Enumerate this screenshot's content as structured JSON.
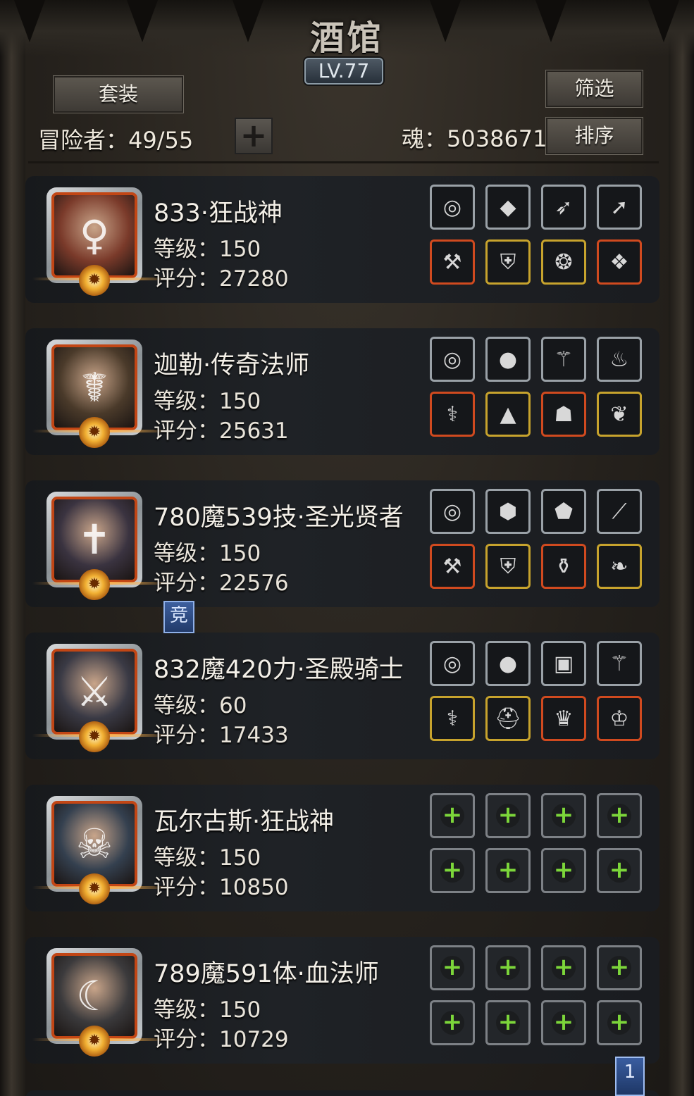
{
  "header": {
    "title": "酒馆",
    "level": "LV.77",
    "set_button": "套装",
    "filter_button": "筛选",
    "sort_button": "排序",
    "adventurers": "冒险者：49/55",
    "add_symbol": "+",
    "soul": "魂：5038671"
  },
  "heroes": [
    {
      "name": "833·狂战神",
      "level": "等级：150",
      "score": "评分：27280",
      "portrait_color": "#7a3a2a",
      "portrait_glyph": "♀",
      "equipment": [
        {
          "icon": "ring",
          "rarity": "silver"
        },
        {
          "icon": "gem",
          "rarity": "silver"
        },
        {
          "icon": "bow",
          "rarity": "silver"
        },
        {
          "icon": "spear",
          "rarity": "silver"
        },
        {
          "icon": "axe",
          "rarity": "red"
        },
        {
          "icon": "armor",
          "rarity": "gold"
        },
        {
          "icon": "circlet",
          "rarity": "gold"
        },
        {
          "icon": "cloak",
          "rarity": "red"
        }
      ]
    },
    {
      "name": "迦勒·传奇法师",
      "level": "等级：150",
      "score": "评分：25631",
      "portrait_color": "#4a3a2a",
      "portrait_glyph": "☤",
      "equipment": [
        {
          "icon": "ring",
          "rarity": "silver"
        },
        {
          "icon": "orb",
          "rarity": "silver"
        },
        {
          "icon": "scepter",
          "rarity": "silver"
        },
        {
          "icon": "lantern",
          "rarity": "silver"
        },
        {
          "icon": "staff",
          "rarity": "red"
        },
        {
          "icon": "robe",
          "rarity": "gold"
        },
        {
          "icon": "mask",
          "rarity": "red"
        },
        {
          "icon": "amulet",
          "rarity": "gold"
        }
      ]
    },
    {
      "name": "780魔539技·圣光贤者",
      "level": "等级：150",
      "score": "评分：22576",
      "portrait_color": "#3a3340",
      "portrait_glyph": "✝",
      "equipment": [
        {
          "icon": "ring",
          "rarity": "silver"
        },
        {
          "icon": "stone",
          "rarity": "silver"
        },
        {
          "icon": "crystal",
          "rarity": "silver"
        },
        {
          "icon": "wand",
          "rarity": "silver"
        },
        {
          "icon": "mace",
          "rarity": "red"
        },
        {
          "icon": "armor",
          "rarity": "gold"
        },
        {
          "icon": "potion",
          "rarity": "red"
        },
        {
          "icon": "pendant",
          "rarity": "gold"
        }
      ]
    },
    {
      "name": "832魔420力·圣殿骑士",
      "level": "等级：60",
      "score": "评分：17433",
      "portrait_color": "#3a3a45",
      "portrait_glyph": "⚔",
      "equipment": [
        {
          "icon": "ring",
          "rarity": "silver"
        },
        {
          "icon": "orb",
          "rarity": "silver"
        },
        {
          "icon": "chest",
          "rarity": "silver"
        },
        {
          "icon": "scepter",
          "rarity": "silver"
        },
        {
          "icon": "staff",
          "rarity": "gold"
        },
        {
          "icon": "helm",
          "rarity": "gold"
        },
        {
          "icon": "crown",
          "rarity": "red"
        },
        {
          "icon": "tiara",
          "rarity": "red"
        }
      ]
    },
    {
      "name": "瓦尔古斯·狂战神",
      "level": "等级：150",
      "score": "评分：10850",
      "portrait_color": "#34404f",
      "portrait_glyph": "☠",
      "equipment": [
        {
          "icon": "plus",
          "rarity": "empty"
        },
        {
          "icon": "plus",
          "rarity": "empty"
        },
        {
          "icon": "plus",
          "rarity": "empty"
        },
        {
          "icon": "plus",
          "rarity": "empty"
        },
        {
          "icon": "plus",
          "rarity": "empty"
        },
        {
          "icon": "plus",
          "rarity": "empty"
        },
        {
          "icon": "plus",
          "rarity": "empty"
        },
        {
          "icon": "plus",
          "rarity": "empty"
        }
      ]
    },
    {
      "name": "789魔591体·血法师",
      "level": "等级：150",
      "score": "评分：10729",
      "portrait_color": "#3b3a3c",
      "portrait_glyph": "☾",
      "equipment": [
        {
          "icon": "plus",
          "rarity": "empty"
        },
        {
          "icon": "plus",
          "rarity": "empty"
        },
        {
          "icon": "plus",
          "rarity": "empty"
        },
        {
          "icon": "plus",
          "rarity": "empty"
        },
        {
          "icon": "plus",
          "rarity": "empty"
        },
        {
          "icon": "plus",
          "rarity": "empty"
        },
        {
          "icon": "plus",
          "rarity": "empty"
        },
        {
          "icon": "plus",
          "rarity": "empty"
        }
      ]
    }
  ],
  "competitive_tag": "竞",
  "page_marker": "1"
}
